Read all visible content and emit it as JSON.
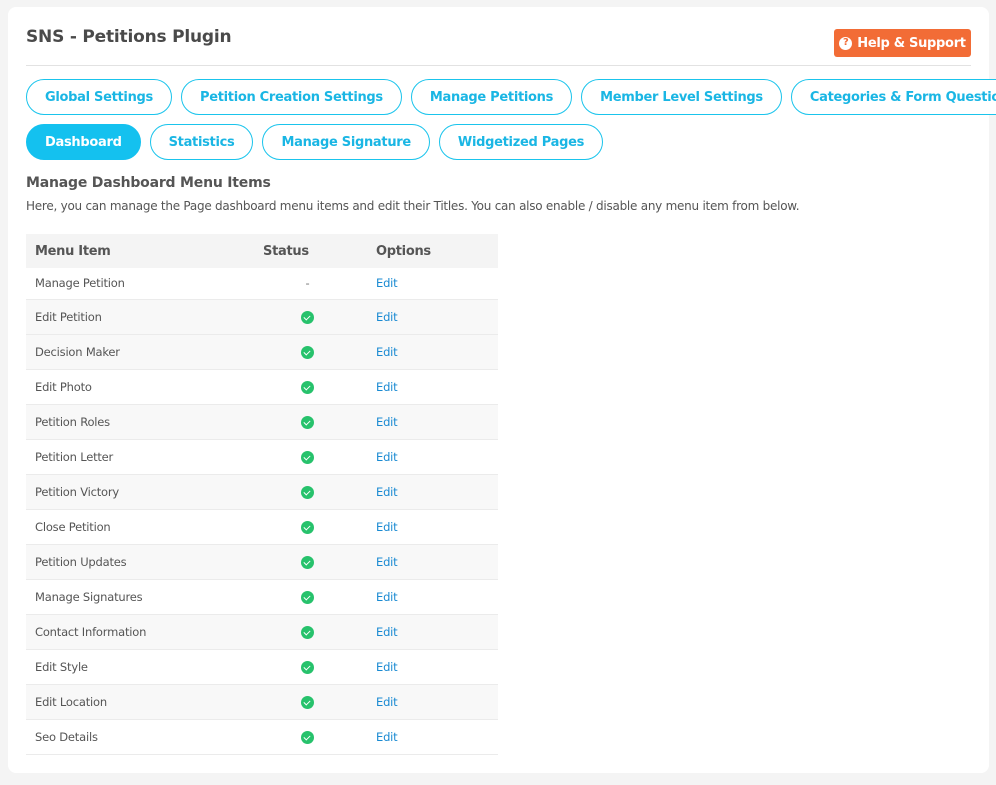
{
  "header": {
    "title": "SNS - Petitions Plugin",
    "help_button": {
      "label": "Help & Support",
      "icon": "question-circle-icon"
    }
  },
  "tabs": {
    "row1": [
      {
        "label": "Global Settings",
        "active": false
      },
      {
        "label": "Petition Creation Settings",
        "active": false
      },
      {
        "label": "Manage Petitions",
        "active": false
      },
      {
        "label": "Member Level Settings",
        "active": false
      },
      {
        "label": "Categories & Form Questions",
        "active": false
      }
    ],
    "row2": [
      {
        "label": "Dashboard",
        "active": true
      },
      {
        "label": "Statistics",
        "active": false
      },
      {
        "label": "Manage Signature",
        "active": false
      },
      {
        "label": "Widgetized Pages",
        "active": false
      }
    ]
  },
  "section": {
    "title": "Manage Dashboard Menu Items",
    "description": "Here, you can manage the Page dashboard menu items and edit their Titles. You can also enable / disable any menu item from below."
  },
  "table": {
    "headers": [
      "Menu Item",
      "Status",
      "Options"
    ],
    "rows": [
      {
        "name": "Manage Petition",
        "status": "-",
        "enabled": null,
        "option": "Edit"
      },
      {
        "name": "Edit Petition",
        "status": "enabled",
        "enabled": true,
        "option": "Edit"
      },
      {
        "name": "Decision Maker",
        "status": "enabled",
        "enabled": true,
        "option": "Edit"
      },
      {
        "name": "Edit Photo",
        "status": "enabled",
        "enabled": true,
        "option": "Edit"
      },
      {
        "name": "Petition Roles",
        "status": "enabled",
        "enabled": true,
        "option": "Edit"
      },
      {
        "name": "Petition Letter",
        "status": "enabled",
        "enabled": true,
        "option": "Edit"
      },
      {
        "name": "Petition Victory",
        "status": "enabled",
        "enabled": true,
        "option": "Edit"
      },
      {
        "name": "Close Petition",
        "status": "enabled",
        "enabled": true,
        "option": "Edit"
      },
      {
        "name": "Petition Updates",
        "status": "enabled",
        "enabled": true,
        "option": "Edit"
      },
      {
        "name": "Manage Signatures",
        "status": "enabled",
        "enabled": true,
        "option": "Edit"
      },
      {
        "name": "Contact Information",
        "status": "enabled",
        "enabled": true,
        "option": "Edit"
      },
      {
        "name": "Edit Style",
        "status": "enabled",
        "enabled": true,
        "option": "Edit"
      },
      {
        "name": "Edit Location",
        "status": "enabled",
        "enabled": true,
        "option": "Edit"
      },
      {
        "name": "Seo Details",
        "status": "enabled",
        "enabled": true,
        "option": "Edit"
      }
    ]
  },
  "colors": {
    "accent": "#14c1ef",
    "help_button": "#f26c36",
    "enabled_check": "#27c26c",
    "link": "#1a8ad2"
  }
}
